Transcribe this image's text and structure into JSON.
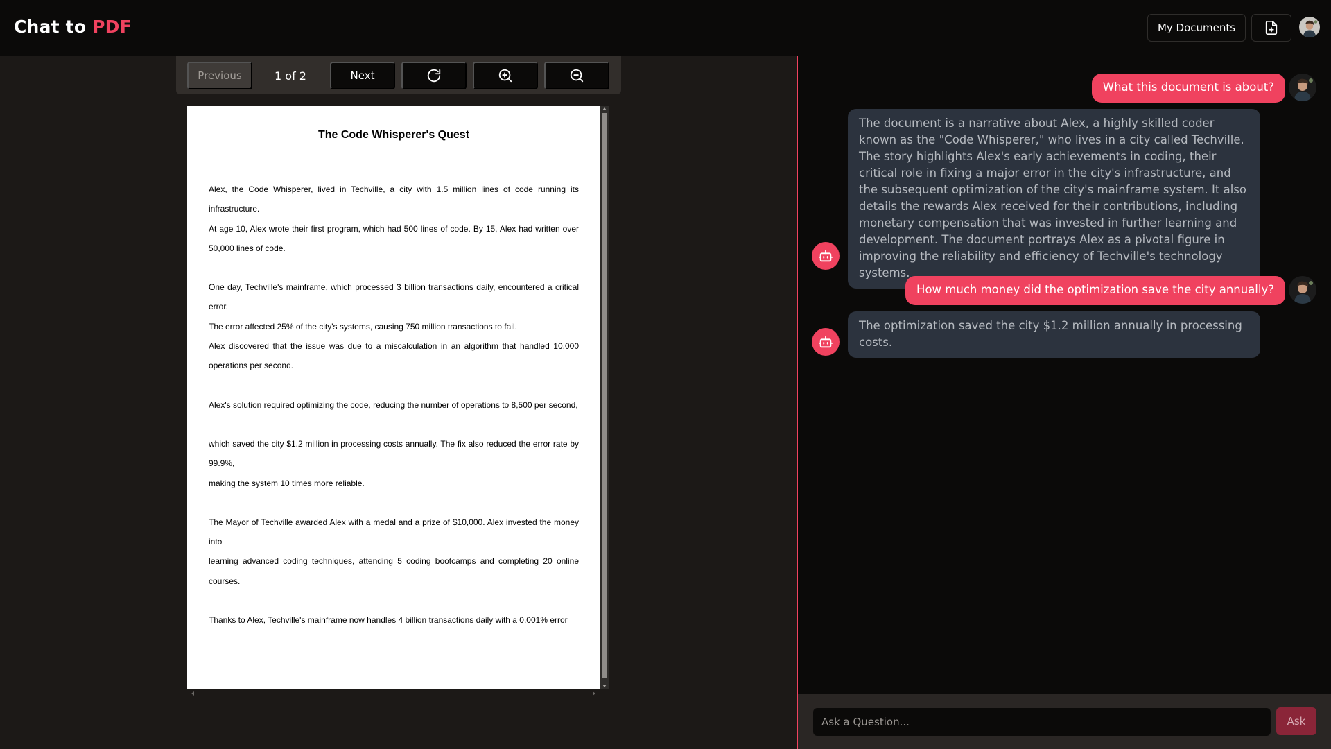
{
  "header": {
    "brand_main": "Chat to",
    "brand_accent": "PDF",
    "my_documents_label": "My Documents",
    "upload_icon": "file-plus-icon",
    "avatar": "user-avatar"
  },
  "colors": {
    "accent": "#f0425f",
    "bot_bubble": "#2c333e",
    "pdf_bg": "#1c1917",
    "background": "#0b0a09"
  },
  "viewer": {
    "previous_label": "Previous",
    "page_indicator": "1 of 2",
    "next_label": "Next",
    "reload_icon": "refresh-icon",
    "zoom_in_icon": "zoom-in-icon",
    "zoom_out_icon": "zoom-out-icon"
  },
  "document": {
    "title": "The Code Whisperer's Quest",
    "paragraphs": [
      "Alex, the Code Whisperer, lived in Techville, a city with 1.5 million lines of code running its infrastructure.",
      "At age 10, Alex wrote their first program, which had 500 lines of code. By 15, Alex had written over 50,000 lines of code.",
      "One day, Techville's mainframe, which processed 3 billion transactions daily, encountered a critical error.",
      "The error affected 25% of the city's systems, causing 750 million transactions to fail.",
      "Alex discovered that the issue was due to a miscalculation in an algorithm that handled 10,000 operations per second.",
      "Alex's solution required optimizing the code, reducing the number of operations to 8,500 per second,",
      "which saved the city $1.2 million in processing costs annually. The fix also reduced the error rate by 99.9%,",
      "making the system 10 times more reliable.",
      "The Mayor of Techville awarded Alex with a medal and a prize of $10,000. Alex invested the money into",
      "learning advanced coding techniques, attending 5 coding bootcamps and completing 20 online courses.",
      "Thanks to Alex, Techville's mainframe now handles 4 billion transactions daily with a 0.001% error"
    ]
  },
  "chat": {
    "messages": [
      {
        "role": "user",
        "text": "What this document is about?"
      },
      {
        "role": "bot",
        "text": "The document is a narrative about Alex, a highly skilled coder known as the \"Code Whisperer,\" who lives in a city called Techville. The story highlights Alex's early achievements in coding, their critical role in fixing a major error in the city's infrastructure, and the subsequent optimization of the city's mainframe system. It also details the rewards Alex received for their contributions, including monetary compensation that was invested in further learning and development. The document portrays Alex as a pivotal figure in improving the reliability and efficiency of Techville's technology systems."
      },
      {
        "role": "user",
        "text": "How much money did the optimization save the city annually?"
      },
      {
        "role": "bot",
        "text": "The optimization saved the city $1.2 million annually in processing costs."
      }
    ],
    "input_placeholder": "Ask a Question...",
    "input_value": "",
    "ask_label": "Ask"
  }
}
